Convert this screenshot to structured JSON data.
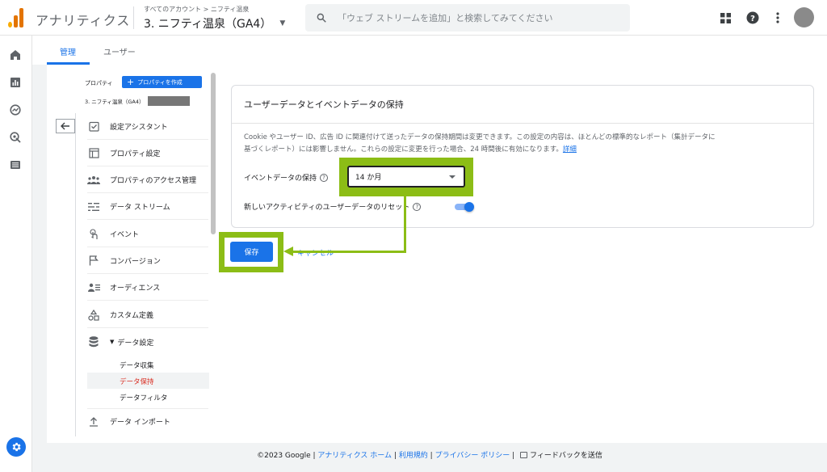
{
  "header": {
    "app_title": "アナリティクス",
    "breadcrumb": "すべてのアカウント > ニフティ温泉",
    "property": "3. ニフティ温泉（GA4）",
    "search_placeholder": "「ウェブ ストリームを追加」と検索してみてください"
  },
  "tabs": [
    {
      "label": "管理"
    },
    {
      "label": "ユーザー"
    }
  ],
  "admin_nav": {
    "column_label": "プロパティ",
    "create_button": "プロパティを作成",
    "property_name": "3. ニフティ温泉（GA4）",
    "items": [
      {
        "label": "設定アシスタント"
      },
      {
        "label": "プロパティ設定"
      },
      {
        "label": "プロパティのアクセス管理"
      },
      {
        "label": "データ ストリーム"
      },
      {
        "label": "イベント"
      },
      {
        "label": "コンバージョン"
      },
      {
        "label": "オーディエンス"
      },
      {
        "label": "カスタム定義"
      },
      {
        "label": "データ設定"
      },
      {
        "label": "データ インポート"
      }
    ],
    "sub_items": [
      {
        "label": "データ収集"
      },
      {
        "label": "データ保持"
      },
      {
        "label": "データフィルタ"
      }
    ]
  },
  "card": {
    "title": "ユーザーデータとイベントデータの保持",
    "description_line1": "Cookie やユーザー ID、広告 ID に関連付けて送ったデータの保持期間は変更できます。この設定の内容は、ほとんどの標準的なレポート（集計データに",
    "description_line2": "基づくレポート）には影響しません。これらの設定に変更を行った場合、24 時間後に有効になります。",
    "details_link": "詳細",
    "event_retention_label": "イベントデータの保持",
    "event_retention_value": "14 か月",
    "reset_label": "新しいアクティビティのユーザーデータのリセット",
    "reset_enabled": true
  },
  "actions": {
    "save": "保存",
    "cancel": "キャンセル"
  },
  "footer": {
    "copyright": "©2023 Google |",
    "analytics_home": "アナリティクス ホーム",
    "terms": "利用規約",
    "privacy": "プライバシー ポリシー",
    "feedback": "フィードバックを送信"
  },
  "colors": {
    "accent": "#1a73e8",
    "highlight": "#8cbd16",
    "active_sub": "#d93025"
  }
}
